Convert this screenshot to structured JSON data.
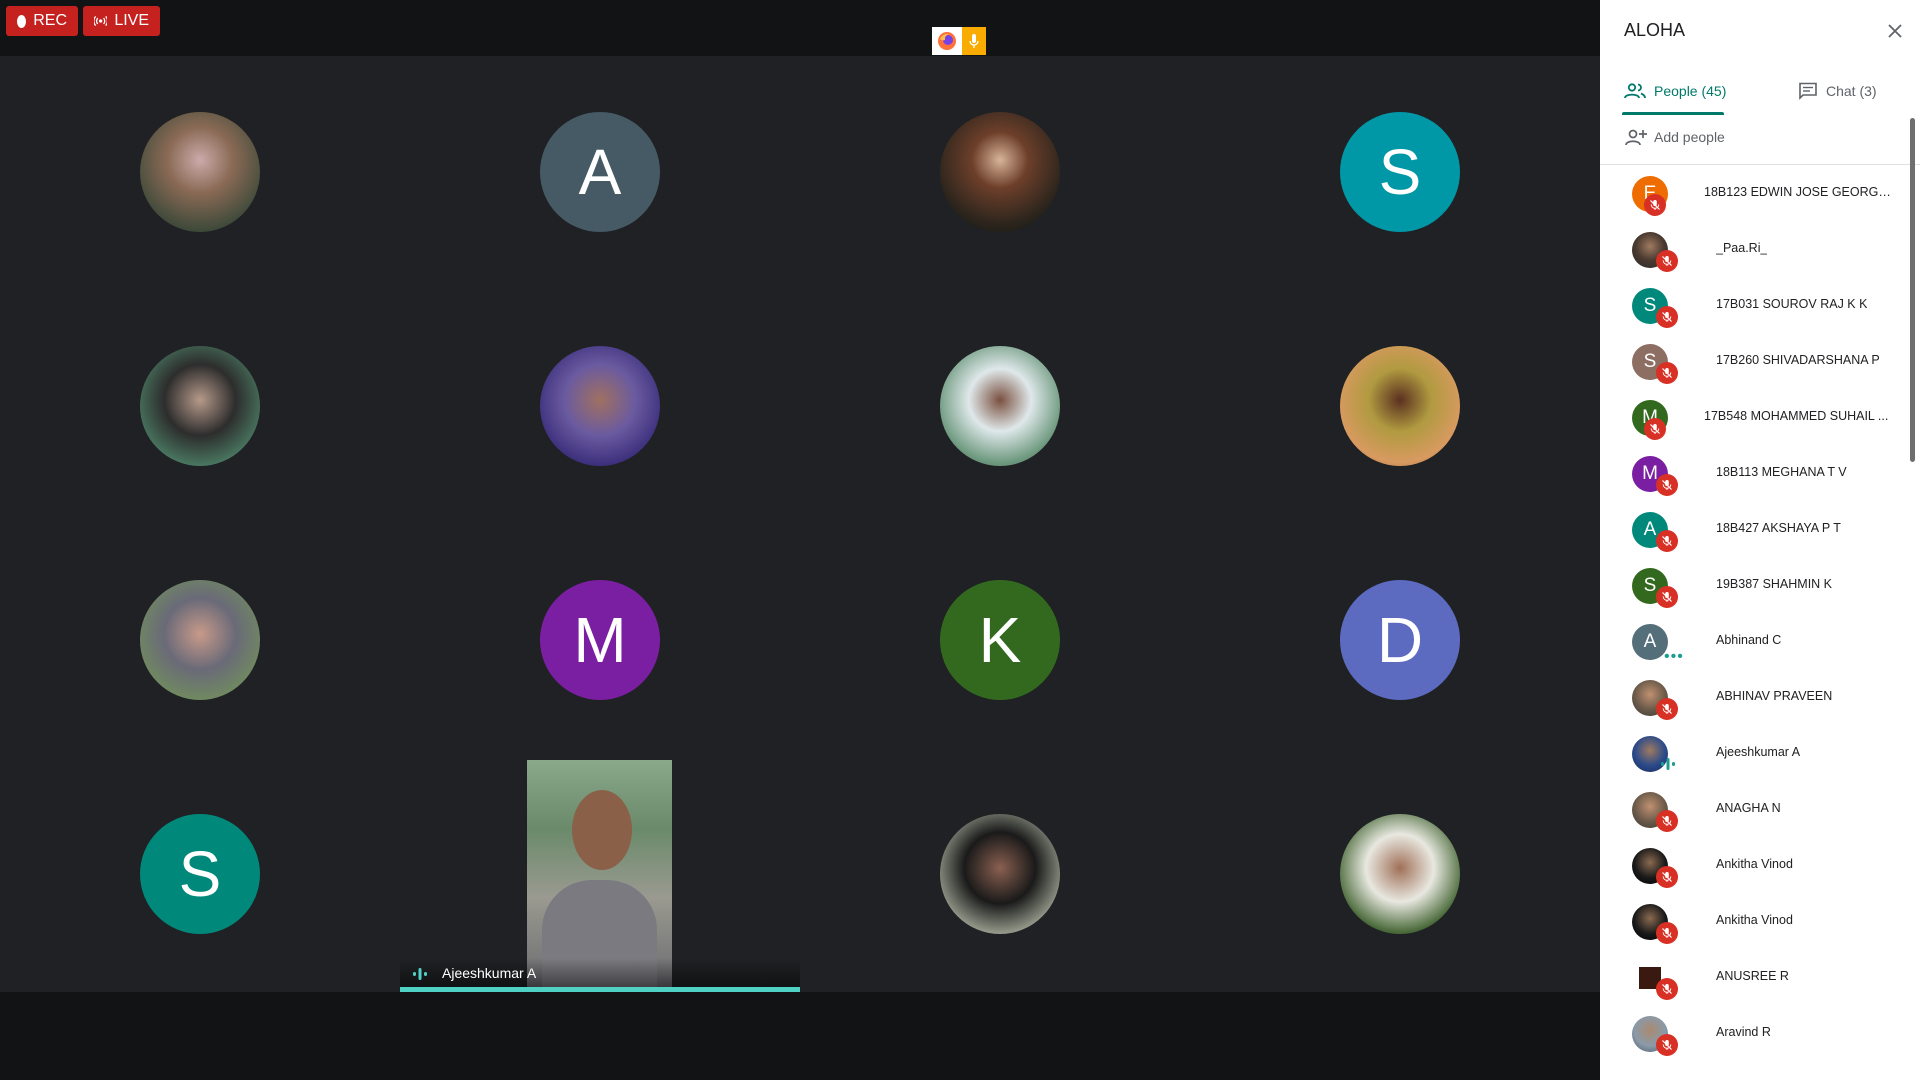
{
  "topbar": {
    "rec_label": "REC",
    "live_label": "LIVE"
  },
  "grid": {
    "tiles": [
      {
        "type": "photo"
      },
      {
        "type": "letter",
        "letter": "A",
        "color": "#455a64"
      },
      {
        "type": "photo"
      },
      {
        "type": "letter",
        "letter": "S",
        "color": "#0097a7"
      },
      {
        "type": "photo"
      },
      {
        "type": "photo"
      },
      {
        "type": "photo"
      },
      {
        "type": "photo"
      },
      {
        "type": "photo"
      },
      {
        "type": "letter",
        "letter": "M",
        "color": "#7b1fa2"
      },
      {
        "type": "letter",
        "letter": "K",
        "color": "#33691e"
      },
      {
        "type": "letter",
        "letter": "D",
        "color": "#5c6bc0"
      },
      {
        "type": "letter",
        "letter": "S",
        "color": "#00897b"
      },
      {
        "type": "video",
        "speaker": "Ajeeshkumar A"
      },
      {
        "type": "photo"
      },
      {
        "type": "photo"
      }
    ]
  },
  "panel": {
    "title": "ALOHA",
    "tab_people": "People (45)",
    "tab_chat": "Chat (3)",
    "add_people": "Add people",
    "people": [
      {
        "initial": "E",
        "color": "#ef6c00",
        "name": "18B123 EDWIN JOSE GEORGE ...",
        "status": "muted"
      },
      {
        "initial": "",
        "color": "",
        "name": "_Paa.Ri_",
        "status": "muted"
      },
      {
        "initial": "S",
        "color": "#00897b",
        "name": "17B031 SOUROV RAJ K K",
        "status": "muted"
      },
      {
        "initial": "S",
        "color": "#8d6e63",
        "name": "17B260 SHIVADARSHANA P",
        "status": "muted"
      },
      {
        "initial": "M",
        "color": "#33691e",
        "name": "17B548 MOHAMMED SUHAIL ...",
        "status": "muted"
      },
      {
        "initial": "M",
        "color": "#7b1fa2",
        "name": "18B113 MEGHANA T V",
        "status": "muted"
      },
      {
        "initial": "A",
        "color": "#00897b",
        "name": "18B427 AKSHAYA P T",
        "status": "muted"
      },
      {
        "initial": "S",
        "color": "#33691e",
        "name": "19B387 SHAHMIN K",
        "status": "muted"
      },
      {
        "initial": "A",
        "color": "#546e7a",
        "name": "Abhinand C",
        "status": "idle"
      },
      {
        "initial": "",
        "color": "",
        "name": "ABHINAV PRAVEEN",
        "status": "muted"
      },
      {
        "initial": "",
        "color": "",
        "name": "Ajeeshkumar A",
        "status": "speaking"
      },
      {
        "initial": "",
        "color": "",
        "name": "ANAGHA N",
        "status": "muted"
      },
      {
        "initial": "",
        "color": "",
        "name": "Ankitha Vinod",
        "status": "muted"
      },
      {
        "initial": "",
        "color": "",
        "name": "Ankitha Vinod",
        "status": "muted"
      },
      {
        "initial": "",
        "color": "",
        "name": "ANUSREE R",
        "status": "muted"
      },
      {
        "initial": "",
        "color": "",
        "name": "Aravind R",
        "status": "muted"
      }
    ]
  }
}
